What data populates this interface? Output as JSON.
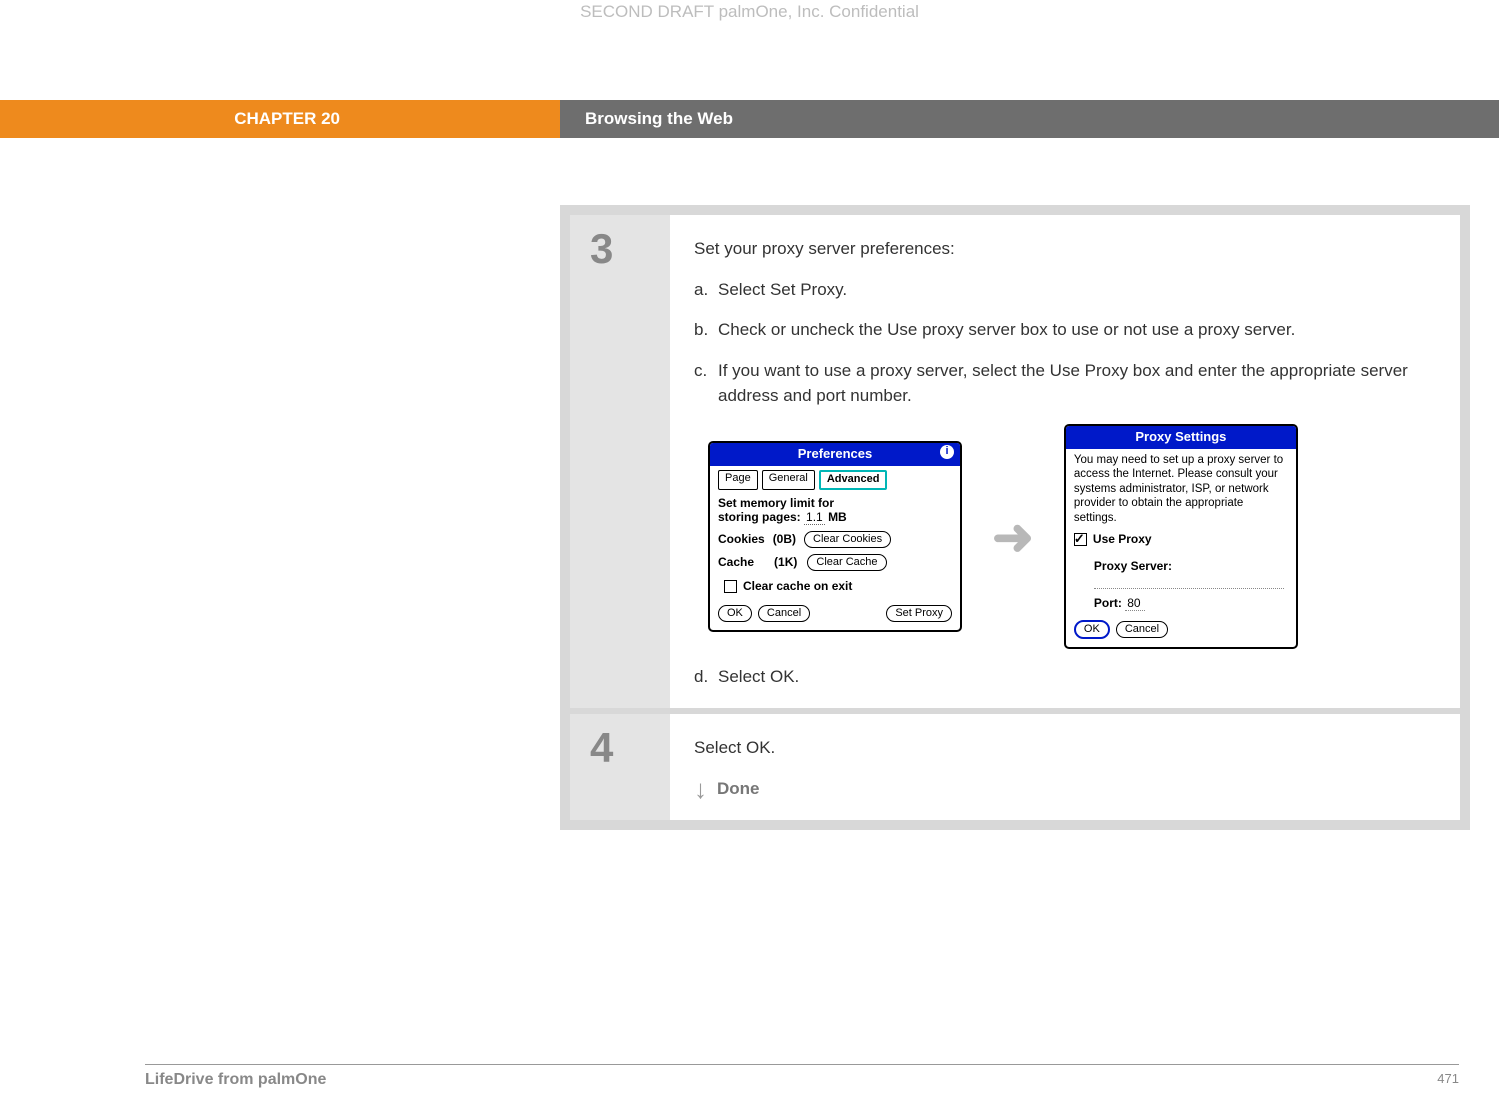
{
  "watermark": "SECOND DRAFT palmOne, Inc.  Confidential",
  "header": {
    "chapter": "CHAPTER 20",
    "title": "Browsing the Web"
  },
  "steps": [
    {
      "num": "3",
      "intro": "Set your proxy server preferences:",
      "subs": [
        {
          "letter": "a.",
          "text": "Select Set Proxy."
        },
        {
          "letter": "b.",
          "text": "Check or uncheck the Use proxy server box to use or not use a proxy server."
        },
        {
          "letter": "c.",
          "text": "If you want to use a proxy server, select the Use Proxy box and enter the appropriate server address and port number."
        },
        {
          "letter": "d.",
          "text": "Select OK."
        }
      ]
    },
    {
      "num": "4",
      "intro": "Select OK.",
      "done": "Done"
    }
  ],
  "prefs_window": {
    "title": "Preferences",
    "tabs": {
      "page": "Page",
      "general": "General",
      "advanced": "Advanced"
    },
    "mem_label_l1": "Set memory limit for",
    "mem_label_l2": "storing pages:",
    "mem_value": "1.1",
    "mem_unit": "MB",
    "cookies_label": "Cookies",
    "cookies_value": "(0B)",
    "clear_cookies": "Clear Cookies",
    "cache_label": "Cache",
    "cache_value": "(1K)",
    "clear_cache": "Clear Cache",
    "clear_on_exit": "Clear cache on exit",
    "ok": "OK",
    "cancel": "Cancel",
    "set_proxy": "Set Proxy"
  },
  "proxy_window": {
    "title": "Proxy Settings",
    "text": "You may need to set up a proxy server to access the Internet. Please consult your systems administrator, ISP, or network provider to obtain the appropriate settings.",
    "use_proxy": "Use Proxy",
    "server_label": "Proxy Server:",
    "port_label": "Port:",
    "port_value": "80",
    "ok": "OK",
    "cancel": "Cancel"
  },
  "footer": {
    "product": "LifeDrive from palmOne",
    "page": "471"
  }
}
